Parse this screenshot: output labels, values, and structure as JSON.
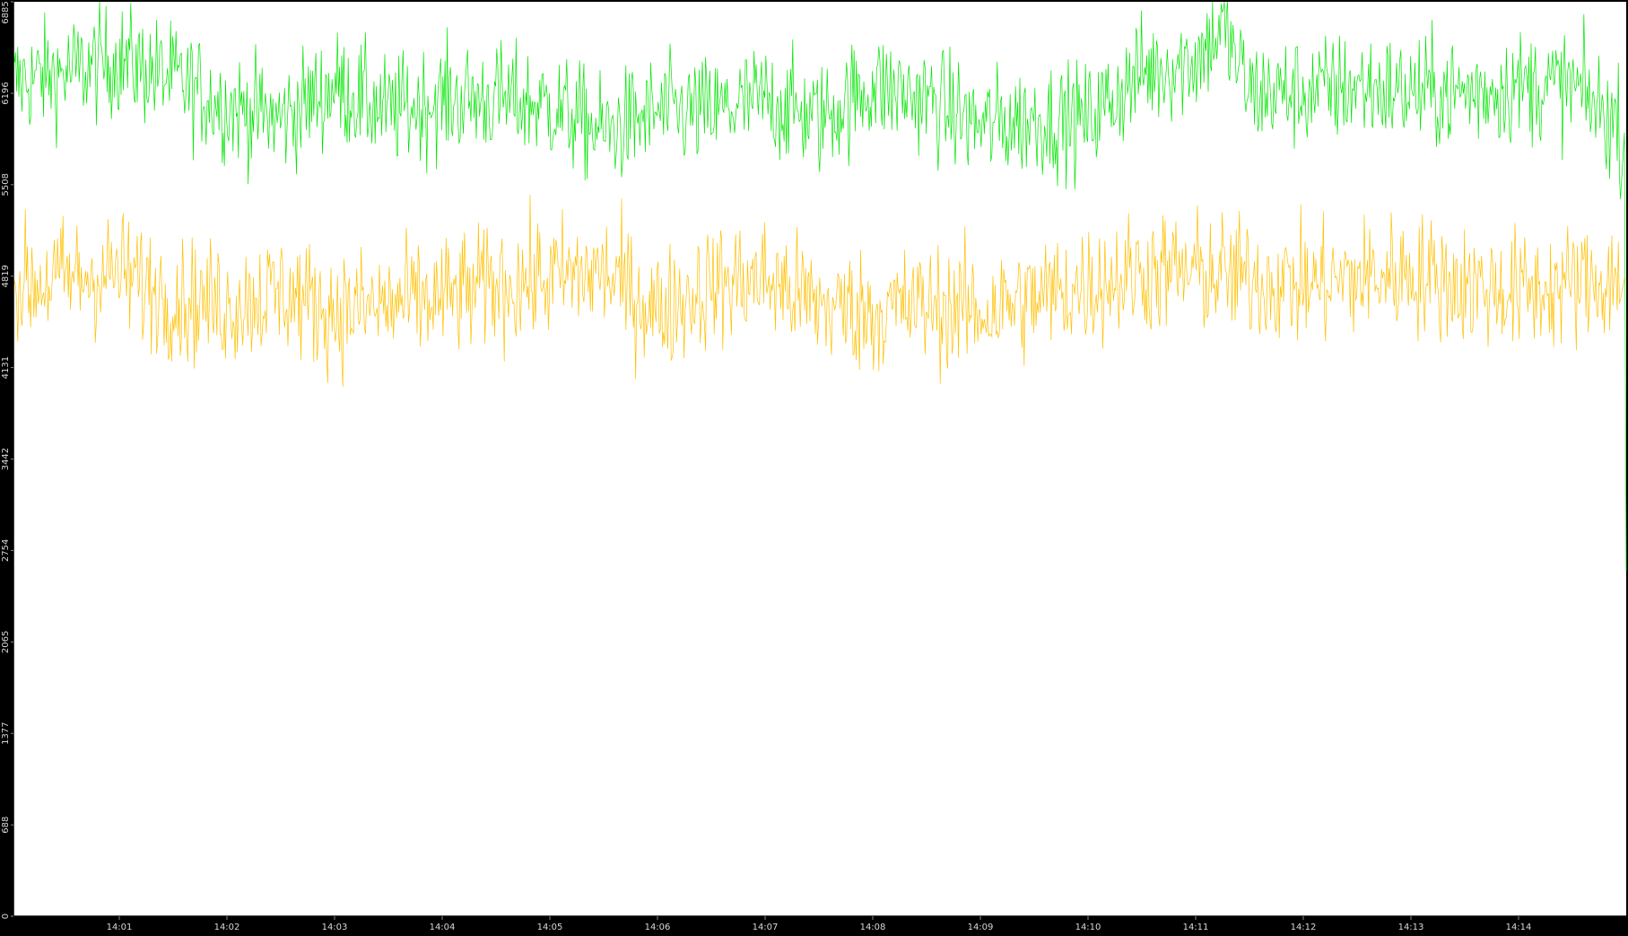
{
  "colors": {
    "background": "#000000",
    "plot_background": "#ffffff",
    "axis": "#000000",
    "green_series": "#00e600",
    "orange_series": "#ffc000"
  },
  "chart_data": {
    "type": "line",
    "title": "",
    "xlabel": "",
    "ylabel": "",
    "ylim": [
      0,
      6885
    ],
    "xlim": [
      "14:00:01",
      "14:15:00"
    ],
    "x_ticks": [
      "14:01",
      "14:02",
      "14:03",
      "14:04",
      "14:05",
      "14:06",
      "14:07",
      "14:08",
      "14:09",
      "14:10",
      "14:11",
      "14:12",
      "14:13",
      "14:14"
    ],
    "y_ticks": [
      0,
      688,
      1377,
      2065,
      2754,
      3442,
      4131,
      4819,
      5508,
      6196,
      6885
    ],
    "grid": false,
    "legend": "none",
    "series": [
      {
        "color": "#00e600",
        "x": [
          "14:00:01",
          "14:00:30",
          "14:01:00",
          "14:01:30",
          "14:02:00",
          "14:02:30",
          "14:03:00",
          "14:03:30",
          "14:04:00",
          "14:04:30",
          "14:05:00",
          "14:05:30",
          "14:06:00",
          "14:06:30",
          "14:07:00",
          "14:07:30",
          "14:08:00",
          "14:08:30",
          "14:09:00",
          "14:09:30",
          "14:10:00",
          "14:10:30",
          "14:11:00",
          "14:11:15",
          "14:11:30",
          "14:12:00",
          "14:12:30",
          "14:13:00",
          "14:13:30",
          "14:14:00",
          "14:14:30",
          "14:15:00"
        ],
        "values": [
          6280,
          6350,
          6450,
          6300,
          6100,
          6000,
          6250,
          6050,
          6150,
          6150,
          6100,
          5900,
          6050,
          6050,
          6150,
          6000,
          6250,
          6150,
          5950,
          6000,
          6000,
          6350,
          6450,
          6700,
          6200,
          6200,
          6250,
          6200,
          6200,
          6250,
          6250,
          5900
        ]
      },
      {
        "color": "#ffc000",
        "x": [
          "14:00:01",
          "14:00:30",
          "14:01:00",
          "14:01:30",
          "14:02:00",
          "14:02:30",
          "14:03:00",
          "14:03:30",
          "14:04:00",
          "14:04:30",
          "14:05:00",
          "14:05:30",
          "14:06:00",
          "14:06:30",
          "14:07:00",
          "14:07:30",
          "14:08:00",
          "14:08:30",
          "14:09:00",
          "14:09:30",
          "14:10:00",
          "14:10:30",
          "14:11:00",
          "14:11:30",
          "14:12:00",
          "14:12:30",
          "14:13:00",
          "14:13:30",
          "14:14:00",
          "14:14:30",
          "14:15:00"
        ],
        "values": [
          4750,
          4800,
          4850,
          4650,
          4600,
          4700,
          4550,
          4600,
          4650,
          4750,
          4800,
          4850,
          4550,
          4750,
          4800,
          4600,
          4550,
          4600,
          4550,
          4650,
          4750,
          4850,
          4850,
          4800,
          4750,
          4800,
          4850,
          4750,
          4700,
          4750,
          4800
        ]
      }
    ]
  }
}
